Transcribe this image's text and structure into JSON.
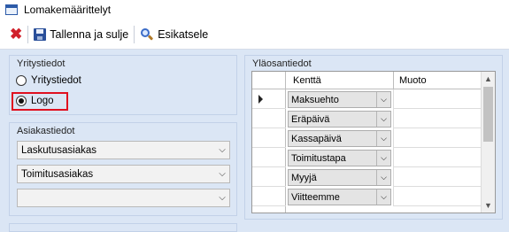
{
  "window": {
    "title": "Lomakemäärittelyt",
    "app_icon": "form-window-icon"
  },
  "toolbar": {
    "delete_icon": "red-x-icon",
    "save_close_label": "Tallenna ja sulje",
    "save_icon": "floppy-disk-icon",
    "preview_label": "Esikatsele",
    "preview_icon": "magnifier-icon"
  },
  "company_info": {
    "title": "Yritystiedot",
    "options": [
      {
        "label": "Yritystiedot",
        "checked": false
      },
      {
        "label": "Logo",
        "checked": true
      }
    ],
    "highlight_color": "#e01020"
  },
  "customer_info": {
    "title": "Asiakastiedot",
    "combos": [
      {
        "value": "Laskutusasiakas"
      },
      {
        "value": "Toimitusasiakas"
      },
      {
        "value": ""
      }
    ]
  },
  "header_info": {
    "title": "Yläosantiedot",
    "columns": [
      "Kenttä",
      "Muoto"
    ],
    "rows": [
      {
        "field": "Maksuehto",
        "format": "",
        "current": true
      },
      {
        "field": "Eräpäivä",
        "format": ""
      },
      {
        "field": "Kassapäivä",
        "format": ""
      },
      {
        "field": "Toimitustapa",
        "format": ""
      },
      {
        "field": "Myyjä",
        "format": ""
      },
      {
        "field": "Viitteemme",
        "format": ""
      }
    ]
  }
}
